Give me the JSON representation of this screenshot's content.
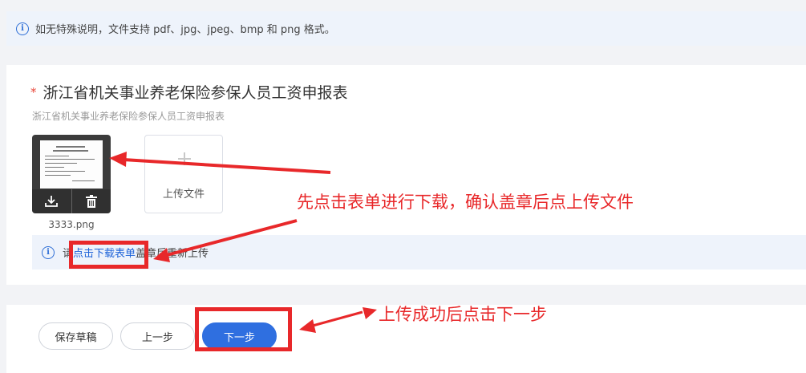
{
  "notice": {
    "text": "如无特殊说明，文件支持 pdf、jpg、jpeg、bmp 和 png 格式。",
    "icon": "info-icon"
  },
  "field": {
    "required_mark": "*",
    "title": "浙江省机关事业养老保险参保人员工资申报表",
    "description": "浙江省机关事业养老保险参保人员工资申报表"
  },
  "upload": {
    "file_name": "3333.png",
    "upload_label": "上传文件",
    "actions": [
      "download-icon",
      "trash-icon"
    ]
  },
  "tip": {
    "prefix": "请",
    "link": "点击下载表单",
    "suffix": "盖章后重新上传"
  },
  "footer": {
    "save_draft": "保存草稿",
    "prev": "上一步",
    "next": "下一步"
  },
  "annotations": {
    "step1": "先点击表单进行下载，确认盖章后点上传文件",
    "step2": "上传成功后点击下一步",
    "color": "#e8282a"
  },
  "colors": {
    "accent": "#2f6fe0",
    "link": "#1e63d8",
    "required": "#e8473a",
    "info_bg": "#eef3fb"
  }
}
